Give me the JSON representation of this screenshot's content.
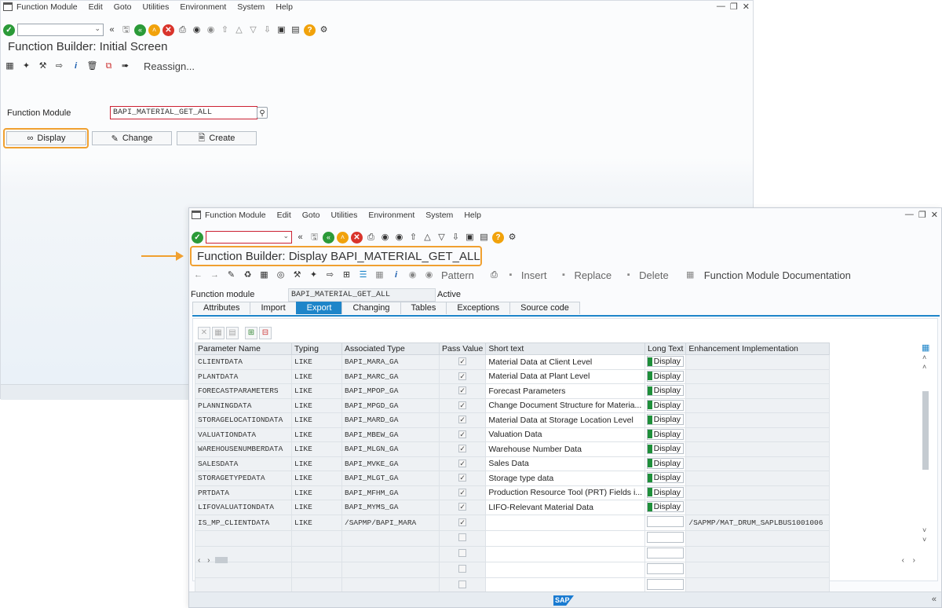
{
  "colors": {
    "accent": "#1e85c9",
    "highlight": "#f0a030",
    "green": "#2b9a38"
  },
  "menu": [
    "Function Module",
    "Edit",
    "Goto",
    "Utilities",
    "Environment",
    "System",
    "Help"
  ],
  "window1": {
    "title": "Function Builder: Initial Screen",
    "reassign_label": "Reassign...",
    "field_label": "Function Module",
    "field_value": "BAPI_MATERIAL_GET_ALL",
    "buttons": {
      "display": "Display",
      "change": "Change",
      "create": "Create"
    }
  },
  "window2": {
    "title": "Function Builder: Display BAPI_MATERIAL_GET_ALL",
    "toolbar": {
      "pattern": "Pattern",
      "insert": "Insert",
      "replace": "Replace",
      "delete": "Delete",
      "doc": "Function Module Documentation"
    },
    "fm_label": "Function module",
    "fm_value": "BAPI_MATERIAL_GET_ALL",
    "fm_status": "Active",
    "tabs": [
      "Attributes",
      "Import",
      "Export",
      "Changing",
      "Tables",
      "Exceptions",
      "Source code"
    ],
    "active_tab": "Export",
    "columns": [
      "Parameter Name",
      "Typing",
      "Associated Type",
      "Pass Value",
      "Short text",
      "Long Text",
      "Enhancement Implementation"
    ],
    "long_text_button": "Display",
    "rows": [
      {
        "name": "CLIENTDATA",
        "typing": "LIKE",
        "type": "BAPI_MARA_GA",
        "pass": true,
        "text": "Material Data at Client Level",
        "longtext": true,
        "enh": ""
      },
      {
        "name": "PLANTDATA",
        "typing": "LIKE",
        "type": "BAPI_MARC_GA",
        "pass": true,
        "text": "Material Data at Plant Level",
        "longtext": true,
        "enh": ""
      },
      {
        "name": "FORECASTPARAMETERS",
        "typing": "LIKE",
        "type": "BAPI_MPOP_GA",
        "pass": true,
        "text": "Forecast Parameters",
        "longtext": true,
        "enh": ""
      },
      {
        "name": "PLANNINGDATA",
        "typing": "LIKE",
        "type": "BAPI_MPGD_GA",
        "pass": true,
        "text": "Change Document Structure for Materia...",
        "longtext": true,
        "enh": ""
      },
      {
        "name": "STORAGELOCATIONDATA",
        "typing": "LIKE",
        "type": "BAPI_MARD_GA",
        "pass": true,
        "text": "Material Data at Storage Location Level",
        "longtext": true,
        "enh": ""
      },
      {
        "name": "VALUATIONDATA",
        "typing": "LIKE",
        "type": "BAPI_MBEW_GA",
        "pass": true,
        "text": "Valuation Data",
        "longtext": true,
        "enh": ""
      },
      {
        "name": "WAREHOUSENUMBERDATA",
        "typing": "LIKE",
        "type": "BAPI_MLGN_GA",
        "pass": true,
        "text": "Warehouse Number Data",
        "longtext": true,
        "enh": ""
      },
      {
        "name": "SALESDATA",
        "typing": "LIKE",
        "type": "BAPI_MVKE_GA",
        "pass": true,
        "text": "Sales Data",
        "longtext": true,
        "enh": ""
      },
      {
        "name": "STORAGETYPEDATA",
        "typing": "LIKE",
        "type": "BAPI_MLGT_GA",
        "pass": true,
        "text": "Storage type data",
        "longtext": true,
        "enh": ""
      },
      {
        "name": "PRTDATA",
        "typing": "LIKE",
        "type": "BAPI_MFHM_GA",
        "pass": true,
        "text": "Production Resource Tool (PRT) Fields i...",
        "longtext": true,
        "enh": ""
      },
      {
        "name": "LIFOVALUATIONDATA",
        "typing": "LIKE",
        "type": "BAPI_MYMS_GA",
        "pass": true,
        "text": "LIFO-Relevant Material Data",
        "longtext": true,
        "enh": ""
      },
      {
        "name": "IS_MP_CLIENTDATA",
        "typing": "LIKE",
        "type": "/SAPMP/BAPI_MARA",
        "pass": true,
        "text": "",
        "longtext": false,
        "enh": "/SAPMP/MAT_DRUM_SAPLBUS1001006"
      },
      {
        "name": "",
        "typing": "",
        "type": "",
        "pass": false,
        "text": "",
        "longtext": false,
        "enh": ""
      },
      {
        "name": "",
        "typing": "",
        "type": "",
        "pass": false,
        "text": "",
        "longtext": false,
        "enh": ""
      },
      {
        "name": "",
        "typing": "",
        "type": "",
        "pass": false,
        "text": "",
        "longtext": false,
        "enh": ""
      },
      {
        "name": "",
        "typing": "",
        "type": "",
        "pass": false,
        "text": "",
        "longtext": false,
        "enh": ""
      }
    ],
    "sap_logo": "SAP"
  }
}
